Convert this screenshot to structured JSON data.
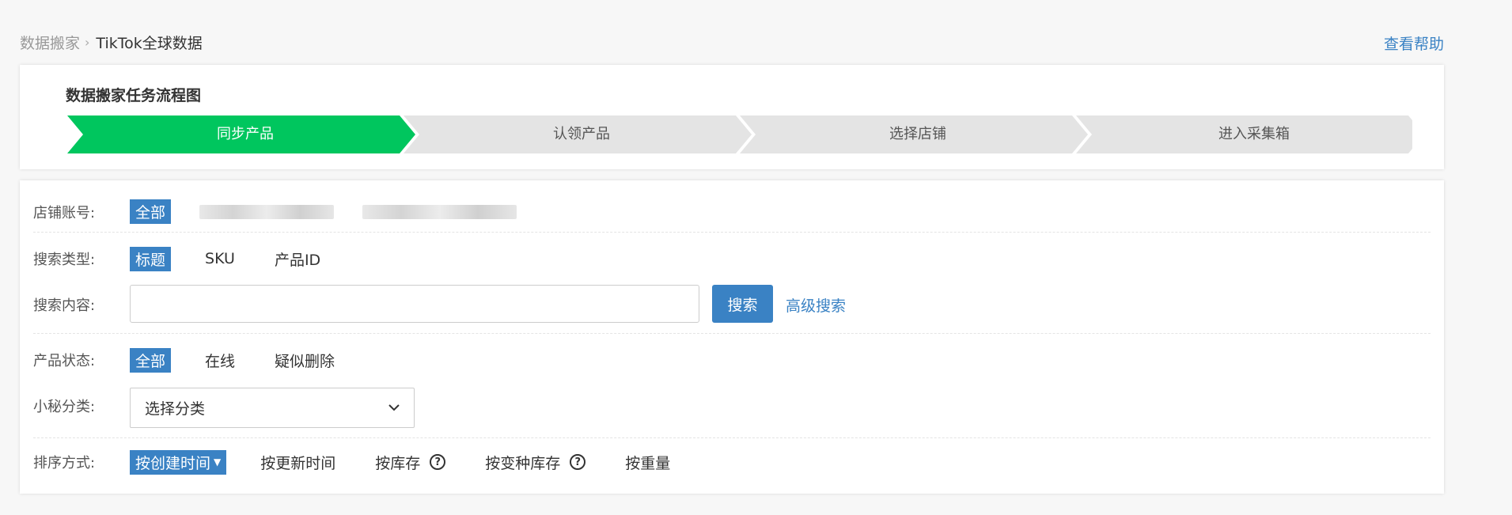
{
  "breadcrumb": {
    "root": "数据搬家",
    "separator": ">",
    "current": "TikTok全球数据"
  },
  "help_link": "查看帮助",
  "flow": {
    "title": "数据搬家任务流程图",
    "steps": [
      {
        "label": "同步产品",
        "active": true
      },
      {
        "label": "认领产品",
        "active": false
      },
      {
        "label": "选择店铺",
        "active": false
      },
      {
        "label": "进入采集箱",
        "active": false
      }
    ],
    "active_color": "#00c65e",
    "inactive_color": "#e4e4e4"
  },
  "filters": {
    "shop": {
      "label": "店铺账号:",
      "options": [
        "全部"
      ]
    },
    "search_type": {
      "label": "搜索类型:",
      "options": [
        "标题",
        "SKU",
        "产品ID"
      ]
    },
    "search_content": {
      "label": "搜索内容:",
      "value": "",
      "placeholder": "",
      "search_button": "搜索",
      "advanced_link": "高级搜索"
    },
    "product_status": {
      "label": "产品状态:",
      "options": [
        "全部",
        "在线",
        "疑似删除"
      ]
    },
    "category": {
      "label": "小秘分类:",
      "selected": "选择分类",
      "chevron_icon": "chevron-down-icon"
    },
    "sort": {
      "label": "排序方式:",
      "options": [
        "按创建时间",
        "按更新时间",
        "按库存",
        "按变种库存",
        "按重量"
      ],
      "help_icon": "question-circle-icon"
    }
  },
  "colors": {
    "accent": "#3a82c4",
    "step_active": "#00c65e"
  }
}
